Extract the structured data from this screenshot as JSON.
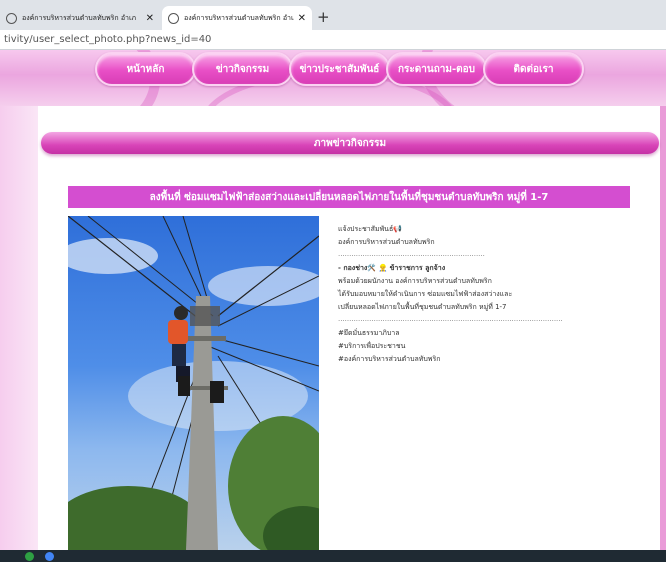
{
  "browser": {
    "tabs": [
      {
        "title": "องค์การบริหารส่วนตำบลทับพริก อำเภ",
        "active": false
      },
      {
        "title": "องค์การบริหารส่วนตำบลทับพริก อำเภ",
        "active": true
      }
    ],
    "new_tab": "+",
    "close_glyph": "✕",
    "url": "tivity/user_select_photo.php?news_id=40"
  },
  "nav": {
    "items": [
      {
        "label": "หน้าหลัก"
      },
      {
        "label": "ข่าวกิจกรรม"
      },
      {
        "label": "ข่าวประชาสัมพันธ์"
      },
      {
        "label": "กระดานถาม-ตอบ"
      },
      {
        "label": "ติดต่อเรา"
      }
    ]
  },
  "section": {
    "title": "ภาพข่าวกิจกรรม"
  },
  "news": {
    "title": "ลงพื้นที่ ซ่อมแซมไฟฟ้าส่องสว่างและเปลี่ยนหลอดไฟภายในพื้นที่ชุมชนตำบลทับพริก หมู่ที่ 1-7",
    "lines": [
      "แจ้งประชาสัมพันธ์📢",
      "องค์การบริหารส่วนตำบลทับพริก",
      "..................................................................",
      "- กองช่าง🛠️ 👷‍♂️ ข้าราชการ ลูกจ้าง",
      "พร้อมด้วยผนักงาน องค์การบริหารส่วนตำบลทับพริก",
      "ได้รับมอบหมายให้ดำเนินการ ซ่อมแซมไฟฟ้าส่องสว่างและ",
      "เปลี่ยนหลอดไฟภายในพื้นที่ชุมชนตำบลทับพริก หมู่ที่ 1-7",
      ".....................................................................................................",
      "#ยึดมั่นธรรมาภิบาล",
      "#บริการเพื่อประชาชน",
      "#องค์การบริหารส่วนตำบลทับพริก"
    ]
  },
  "colors": {
    "accent": "#d844b8",
    "title_bar": "#d44ed0",
    "header_bg": "#eba6df"
  }
}
